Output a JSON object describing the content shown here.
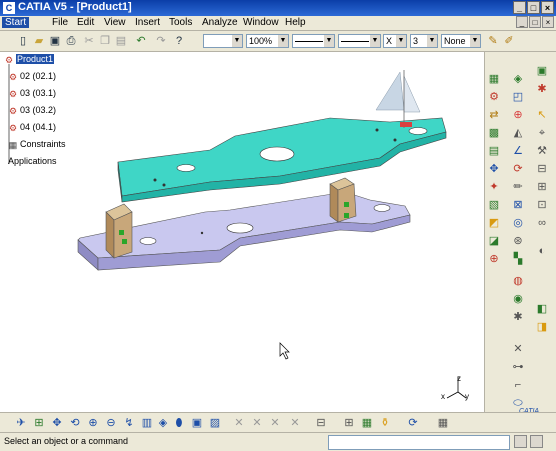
{
  "window": {
    "title": "CATIA V5 - [Product1]",
    "controls": [
      "_",
      "□",
      "×"
    ]
  },
  "menu": {
    "items": [
      "Start",
      "File",
      "Edit",
      "View",
      "Insert",
      "Tools",
      "Analyze",
      "Window",
      "Help"
    ],
    "inner_controls": [
      "_",
      "□",
      "×"
    ]
  },
  "toolbar": {
    "zoom_value": "100%",
    "line_type_value": "",
    "style_value": "",
    "thickness_value": "3",
    "layer_value": "None",
    "x_value": "X"
  },
  "tree": {
    "root": "Product1",
    "items": [
      "02 (02.1)",
      "03 (03.1)",
      "03 (03.2)",
      "04 (04.1)",
      "Constraints",
      "Applications"
    ]
  },
  "compass_axes": {
    "x": "x",
    "y": "y",
    "z": "z"
  },
  "logo": {
    "text": "CATIA"
  },
  "statusbar": {
    "message": "Select an object or a command",
    "command_value": ""
  },
  "colors": {
    "titlebar": "#0b3ea8",
    "top_plate": "#3fd6c6",
    "bottom_plate": "#c9c8ef",
    "support": "#c8a77a",
    "selection": "#1e4fa8"
  }
}
